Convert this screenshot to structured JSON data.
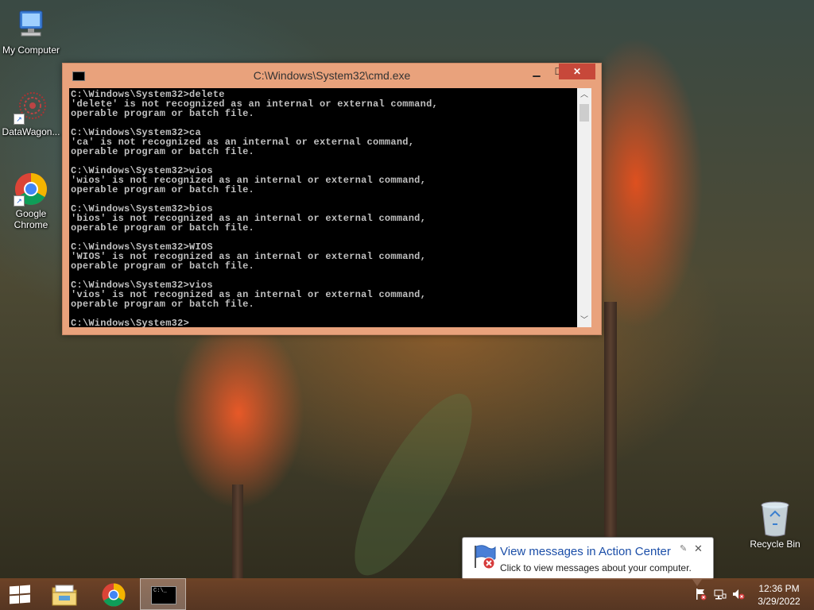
{
  "desktop": {
    "icons": [
      {
        "label": "My Computer",
        "icon": "computer-icon"
      },
      {
        "label": "DataWagon...",
        "icon": "datawagon-icon"
      },
      {
        "label": "Google Chrome",
        "icon": "chrome-icon"
      }
    ],
    "recycle_bin": {
      "label": "Recycle Bin",
      "icon": "recycle-bin-icon"
    }
  },
  "cmd_window": {
    "title": "C:\\Windows\\System32\\cmd.exe",
    "buttons": {
      "minimize": "▁",
      "maximize": "☐",
      "close": "✕"
    },
    "lines": [
      "C:\\Windows\\System32>delete",
      "'delete' is not recognized as an internal or external command,",
      "operable program or batch file.",
      "",
      "C:\\Windows\\System32>ca",
      "'ca' is not recognized as an internal or external command,",
      "operable program or batch file.",
      "",
      "C:\\Windows\\System32>wios",
      "'wios' is not recognized as an internal or external command,",
      "operable program or batch file.",
      "",
      "C:\\Windows\\System32>bios",
      "'bios' is not recognized as an internal or external command,",
      "operable program or batch file.",
      "",
      "C:\\Windows\\System32>WIOS",
      "'WIOS' is not recognized as an internal or external command,",
      "operable program or batch file.",
      "",
      "C:\\Windows\\System32>vios",
      "'vios' is not recognized as an internal or external command,",
      "operable program or batch file.",
      "",
      "C:\\Windows\\System32>"
    ]
  },
  "notification": {
    "title": "View messages in Action Center",
    "subtitle": "Click to view messages about your computer.",
    "close": "✕",
    "pin": "✎"
  },
  "taskbar": {
    "items": [
      {
        "name": "start",
        "icon": "windows-logo-icon"
      },
      {
        "name": "file-explorer",
        "icon": "folder-icon"
      },
      {
        "name": "chrome",
        "icon": "chrome-icon"
      },
      {
        "name": "cmd",
        "icon": "cmd-icon",
        "active": true
      }
    ],
    "tray": {
      "time": "12:36 PM",
      "date": "3/29/2022"
    }
  },
  "colors": {
    "window_frame": "#e9a27c",
    "close_button": "#c7483a",
    "console_bg": "#000000",
    "console_text": "#c0c0c0",
    "balloon_title": "#1b4ea8"
  }
}
